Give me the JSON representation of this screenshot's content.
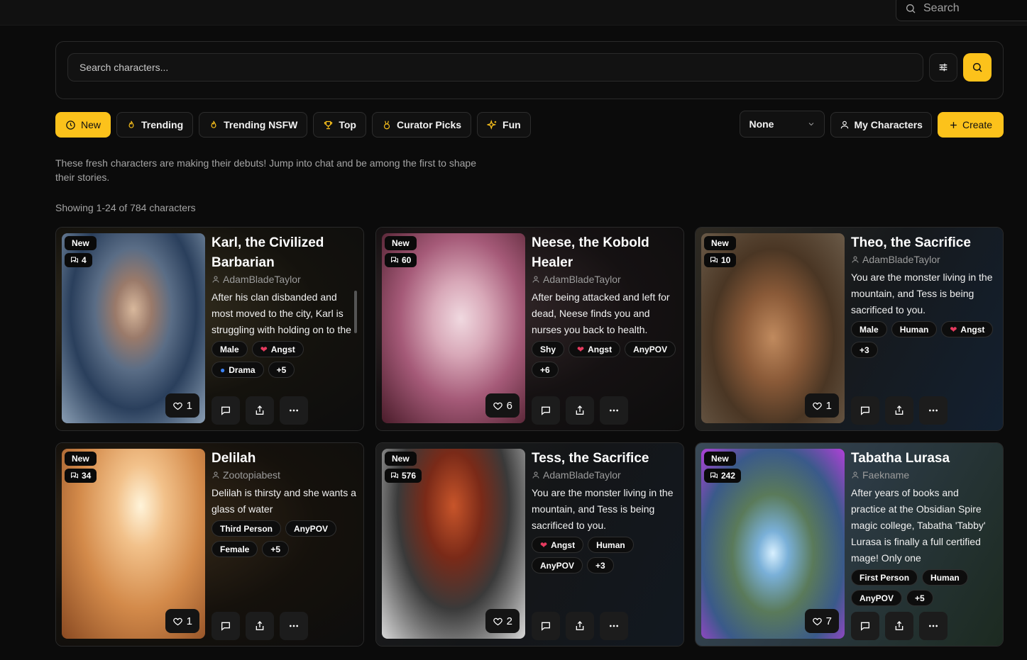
{
  "top_search": {
    "placeholder": "Search"
  },
  "search": {
    "placeholder": "Search characters..."
  },
  "tabs": [
    {
      "label": "New",
      "icon": "clock-icon"
    },
    {
      "label": "Trending",
      "icon": "flame-icon"
    },
    {
      "label": "Trending NSFW",
      "icon": "flame-icon"
    },
    {
      "label": "Top",
      "icon": "trophy-icon"
    },
    {
      "label": "Curator Picks",
      "icon": "medal-icon"
    },
    {
      "label": "Fun",
      "icon": "sparkles-icon"
    }
  ],
  "select": {
    "value": "None"
  },
  "my_characters_label": "My Characters",
  "create_label": "Create",
  "description": "These fresh characters are making their debuts! Jump into chat and be among the first to shape their stories.",
  "showing": "Showing 1-24 of 784 characters",
  "colors": {
    "accent": "#fcc21b",
    "background": "#0b0b0b"
  },
  "cards": [
    {
      "badge": "New",
      "chats": "4",
      "likes": "1",
      "title": "Karl, the Civilized Barbarian",
      "author": "AdamBladeTaylor",
      "blurb": "After his clan disbanded and most moved to the city, Karl is struggling with holding on to the old ways or moving on to",
      "tags": [
        "Male",
        "Angst",
        "Drama",
        "+5"
      ]
    },
    {
      "badge": "New",
      "chats": "60",
      "likes": "6",
      "title": "Neese, the Kobold Healer",
      "author": "AdamBladeTaylor",
      "blurb": "After being attacked and left for dead, Neese finds you and nurses you back to health.",
      "tags": [
        "Shy",
        "Angst",
        "AnyPOV",
        "+6"
      ]
    },
    {
      "badge": "New",
      "chats": "10",
      "likes": "1",
      "title": "Theo, the Sacrifice",
      "author": "AdamBladeTaylor",
      "blurb": "You are the monster living in the mountain, and Tess is being sacrificed to you.",
      "tags": [
        "Male",
        "Human",
        "Angst",
        "+3"
      ]
    },
    {
      "badge": "New",
      "chats": "34",
      "likes": "1",
      "title": "Delilah",
      "author": "Zootopiabest",
      "blurb": "Delilah is thirsty and she wants a glass of water",
      "tags": [
        "Third Person",
        "AnyPOV",
        "Female",
        "+5"
      ]
    },
    {
      "badge": "New",
      "chats": "576",
      "likes": "2",
      "title": "Tess, the Sacrifice",
      "author": "AdamBladeTaylor",
      "blurb": "You are the monster living in the mountain, and Tess is being sacrificed to you.",
      "tags": [
        "Angst",
        "Human",
        "AnyPOV",
        "+3"
      ]
    },
    {
      "badge": "New",
      "chats": "242",
      "likes": "7",
      "title": "Tabatha Lurasa",
      "author": "Faekname",
      "blurb": "After years of books and practice at the Obsidian Spire magic college, Tabatha 'Tabby' Lurasa is finally a full certified mage! Only one",
      "tags": [
        "First Person",
        "Human",
        "AnyPOV",
        "+5"
      ]
    }
  ]
}
